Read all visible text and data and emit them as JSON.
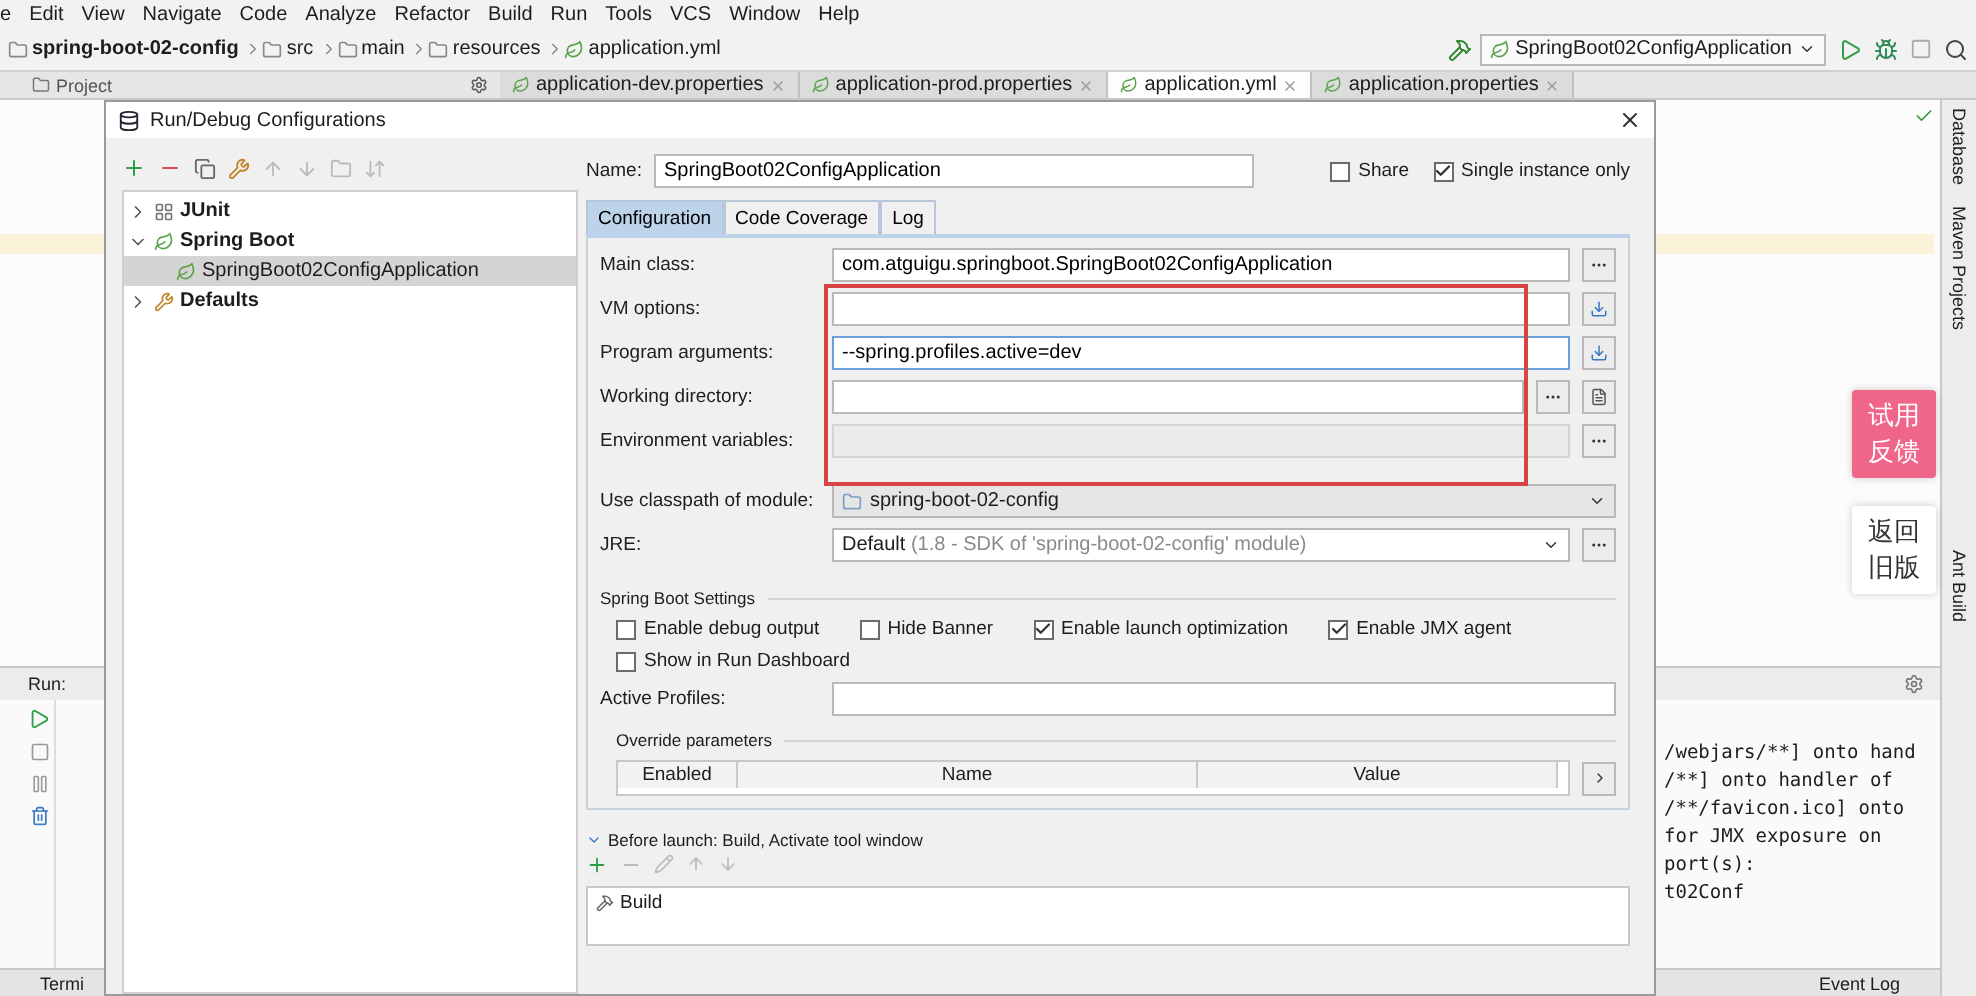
{
  "menu": [
    "e",
    "Edit",
    "View",
    "Navigate",
    "Code",
    "Analyze",
    "Refactor",
    "Build",
    "Run",
    "Tools",
    "VCS",
    "Window",
    "Help"
  ],
  "breadcrumbs": [
    {
      "label": "spring-boot-02-config",
      "kind": "module"
    },
    {
      "label": "src",
      "kind": "folder"
    },
    {
      "label": "main",
      "kind": "folder"
    },
    {
      "label": "resources",
      "kind": "folder"
    },
    {
      "label": "application.yml",
      "kind": "file"
    }
  ],
  "run_config": "SpringBoot02ConfigApplication",
  "project_panel": "Project",
  "editor_tabs": [
    {
      "label": "application-dev.properties",
      "selected": false
    },
    {
      "label": "application-prod.properties",
      "selected": false
    },
    {
      "label": "application.yml",
      "selected": true
    },
    {
      "label": "application.properties",
      "selected": false
    }
  ],
  "right_sidebar": [
    "Database",
    "Maven Projects",
    "Ant Build"
  ],
  "run_panel": {
    "label": "Run:",
    "console_lines": [
      "/webjars/**] onto hand",
      "/**] onto handler of",
      "/**/favicon.ico] onto",
      "for JMX exposure on",
      "port(s):",
      "t02Conf"
    ]
  },
  "bottom_bar": {
    "left": "Termi",
    "right": "Event Log"
  },
  "overlay_buttons": [
    {
      "lines": [
        "试用",
        "反馈"
      ],
      "kind": "accent"
    },
    {
      "lines": [
        "返回",
        "旧版"
      ],
      "kind": "plain"
    }
  ],
  "dialog": {
    "title": "Run/Debug Configurations",
    "tree": [
      {
        "label": "JUnit",
        "expanded": false,
        "selected": false,
        "kind": "junit"
      },
      {
        "label": "Spring Boot",
        "expanded": true,
        "selected": false,
        "kind": "spring",
        "children": [
          {
            "label": "SpringBoot02ConfigApplication",
            "selected": true,
            "kind": "spring"
          }
        ]
      },
      {
        "label": "Defaults",
        "expanded": false,
        "selected": false,
        "kind": "defaults"
      }
    ],
    "name_label": "Name:",
    "name_value": "SpringBoot02ConfigApplication",
    "share": {
      "label": "Share",
      "checked": false
    },
    "single_instance": {
      "label": "Single instance only",
      "checked": true
    },
    "tabs": [
      {
        "label": "Configuration",
        "selected": true
      },
      {
        "label": "Code Coverage",
        "selected": false
      },
      {
        "label": "Log",
        "selected": false
      }
    ],
    "fields": [
      {
        "label": "Main class:",
        "value": "com.atguigu.springboot.SpringBoot02ConfigApplication",
        "kind": "browse"
      },
      {
        "label": "VM options:",
        "kind": "expand"
      },
      {
        "label": "Program arguments:",
        "value": "--spring.profiles.active=dev",
        "kind": "expand"
      },
      {
        "label": "Working directory:",
        "kind": "dir"
      },
      {
        "label": "Environment variables:",
        "kind": "env"
      }
    ],
    "classpath": {
      "label": "Use classpath of module:",
      "value": "spring-boot-02-config"
    },
    "jre": {
      "label": "JRE:",
      "value": "Default",
      "hint": "(1.8 - SDK of 'spring-boot-02-config' module)"
    },
    "settings": {
      "title": "Spring Boot Settings",
      "checkboxes": [
        {
          "label": "Enable debug output",
          "checked": false
        },
        {
          "label": "Hide Banner",
          "checked": false
        },
        {
          "label": "Enable launch optimization",
          "checked": true
        },
        {
          "label": "Enable JMX agent",
          "checked": true
        },
        {
          "label": "Show in Run Dashboard",
          "checked": false
        }
      ]
    },
    "active_profiles": {
      "label": "Active Profiles:"
    },
    "override": {
      "title": "Override parameters",
      "columns": [
        "Enabled",
        "Name",
        "Value"
      ]
    },
    "before_launch": {
      "title": "Before launch: Build, Activate tool window",
      "expanded": true,
      "items": [
        "Build"
      ]
    }
  }
}
